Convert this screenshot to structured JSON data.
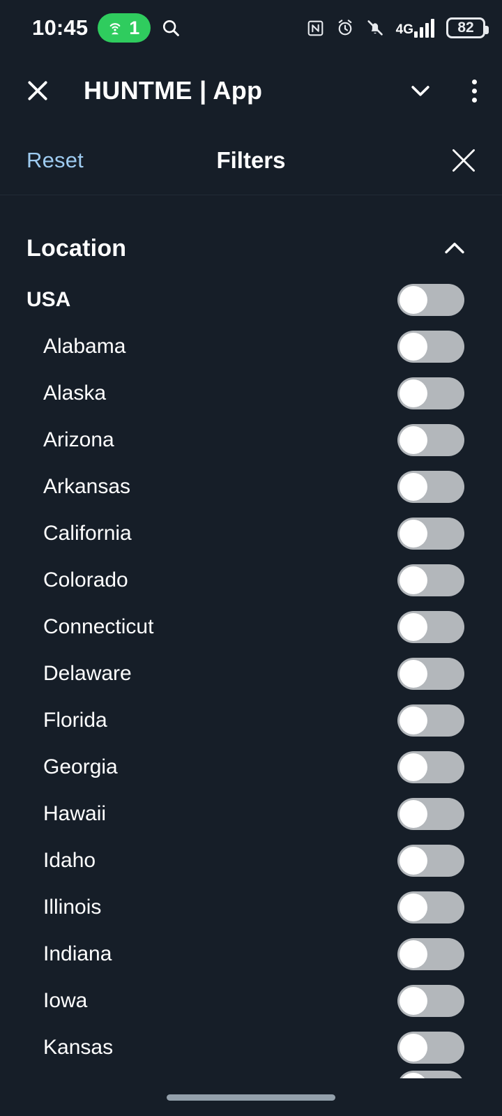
{
  "statusbar": {
    "time": "10:45",
    "hotspot_icon": "wifi-tethering-icon",
    "hotspot_count": "1",
    "search_icon": "search-icon",
    "nfc_icon": "nfc-icon",
    "alarm_icon": "alarm-clock-icon",
    "mute_icon": "bell-muted-icon",
    "network_type": "4G",
    "signal_icon": "signal-bars-icon",
    "battery_level": "82",
    "accent_green": "#2fcc5e"
  },
  "appbar": {
    "close_icon": "close-icon",
    "title": "HUNTME | App",
    "chevron_icon": "chevron-down-icon",
    "menu_icon": "overflow-menu-icon"
  },
  "filters_header": {
    "reset_label": "Reset",
    "title": "Filters",
    "close_icon": "close-icon",
    "reset_color": "#9ecbf0"
  },
  "section": {
    "title": "Location",
    "collapse_icon": "chevron-up-icon",
    "expanded": true
  },
  "rows": [
    {
      "label": "USA",
      "type": "country",
      "enabled": false
    },
    {
      "label": "Alabama",
      "type": "state",
      "enabled": false
    },
    {
      "label": "Alaska",
      "type": "state",
      "enabled": false
    },
    {
      "label": "Arizona",
      "type": "state",
      "enabled": false
    },
    {
      "label": "Arkansas",
      "type": "state",
      "enabled": false
    },
    {
      "label": "California",
      "type": "state",
      "enabled": false
    },
    {
      "label": "Colorado",
      "type": "state",
      "enabled": false
    },
    {
      "label": "Connecticut",
      "type": "state",
      "enabled": false
    },
    {
      "label": "Delaware",
      "type": "state",
      "enabled": false
    },
    {
      "label": "Florida",
      "type": "state",
      "enabled": false
    },
    {
      "label": "Georgia",
      "type": "state",
      "enabled": false
    },
    {
      "label": "Hawaii",
      "type": "state",
      "enabled": false
    },
    {
      "label": "Idaho",
      "type": "state",
      "enabled": false
    },
    {
      "label": "Illinois",
      "type": "state",
      "enabled": false
    },
    {
      "label": "Indiana",
      "type": "state",
      "enabled": false
    },
    {
      "label": "Iowa",
      "type": "state",
      "enabled": false
    },
    {
      "label": "Kansas",
      "type": "state",
      "enabled": false
    }
  ],
  "navbar": {
    "home_indicator": "home-indicator"
  },
  "theme": {
    "background": "#161e28",
    "text": "#ffffff",
    "toggle_track_off": "#b3b7bb",
    "toggle_knob": "#ffffff"
  }
}
